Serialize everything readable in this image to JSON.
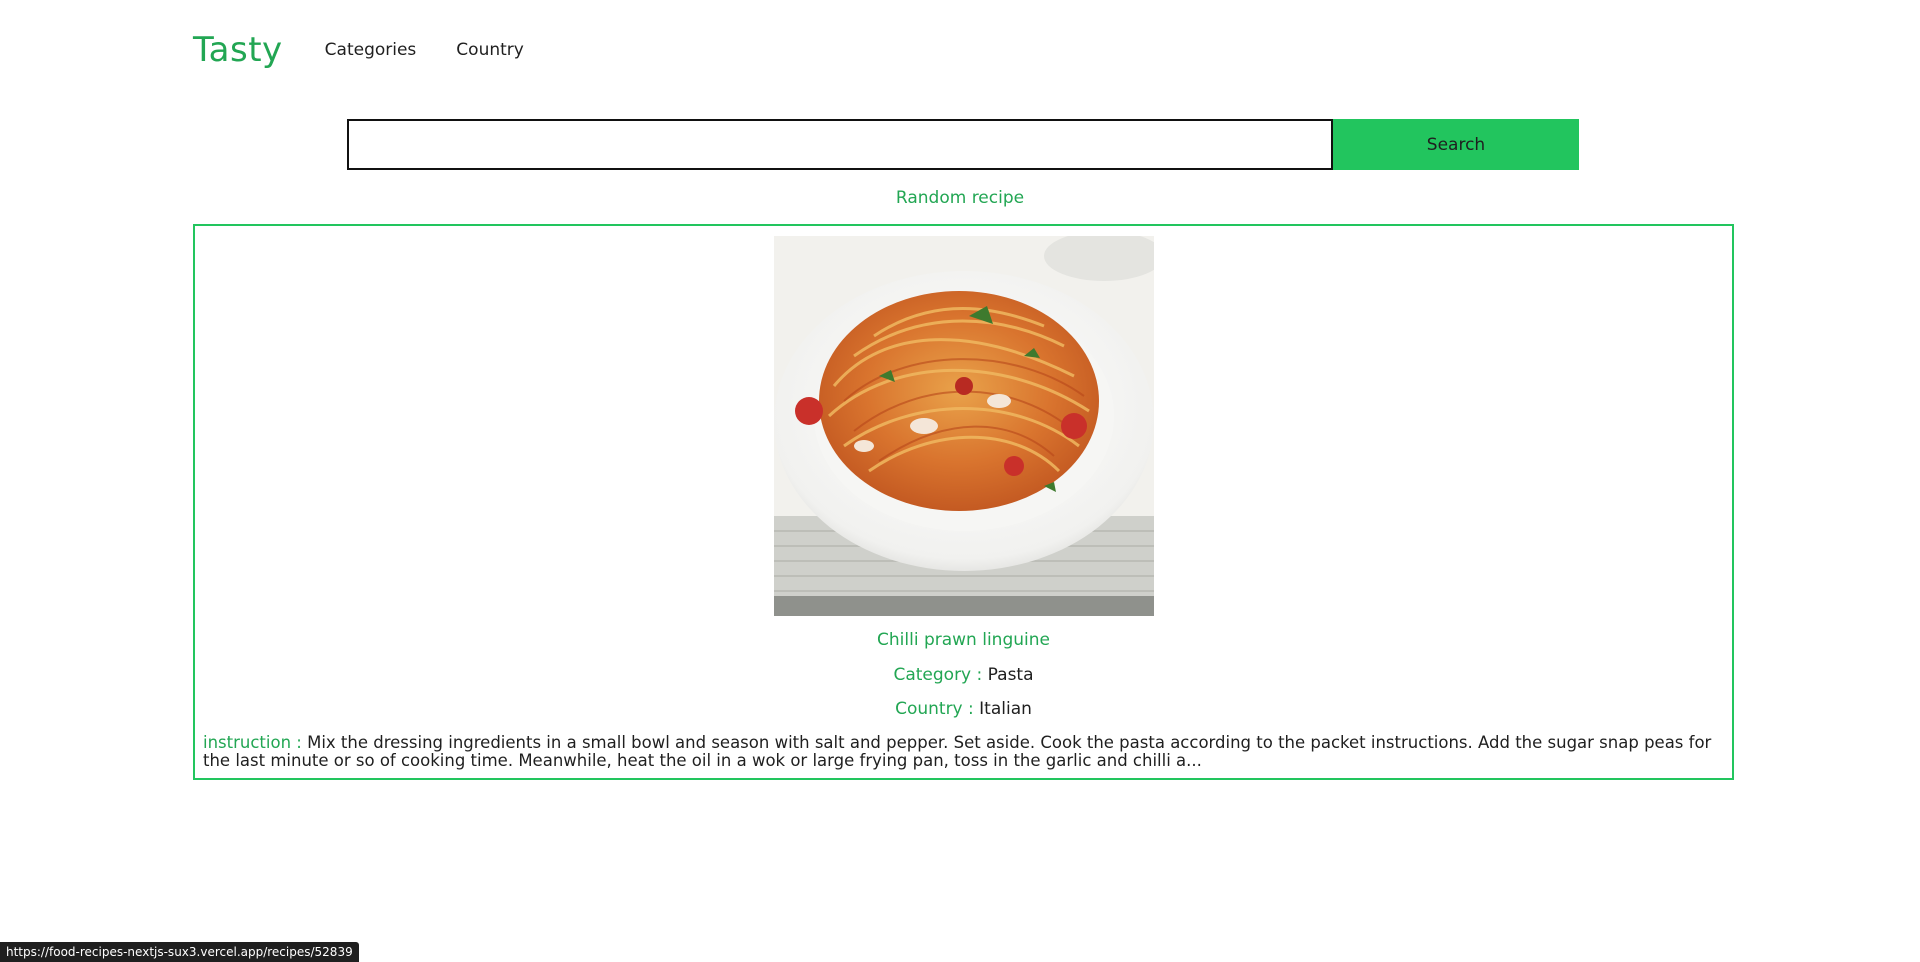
{
  "header": {
    "brand": "Tasty",
    "nav": [
      {
        "label": "Categories"
      },
      {
        "label": "Country"
      }
    ]
  },
  "search": {
    "value": "",
    "placeholder": "",
    "button_label": "Search"
  },
  "random_link": "Random recipe",
  "recipe": {
    "image_alt": "pasta-plate",
    "title": "Chilli prawn linguine",
    "category_label": "Category :",
    "category": "Pasta",
    "country_label": "Country :",
    "country": "Italian",
    "instruction_label": "instruction :",
    "instruction": "Mix the dressing ingredients in a small bowl and season with salt and pepper. Set aside. Cook the pasta according to the packet instructions. Add the sugar snap peas for the last minute or so of cooking time. Meanwhile, heat the oil in a wok or large frying pan, toss in the garlic and chilli a..."
  },
  "status_bar": {
    "url": "https://food-recipes-nextjs-sux3.vercel.app/recipes/52839"
  },
  "colors": {
    "accent": "#22c55e",
    "accent_text": "#22a653"
  }
}
